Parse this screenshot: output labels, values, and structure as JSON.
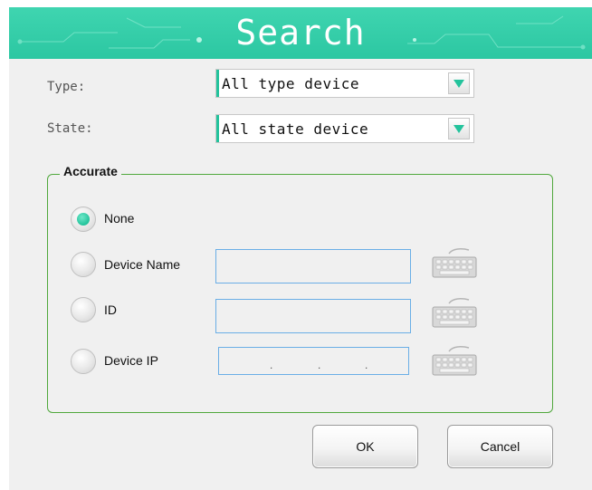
{
  "dialog": {
    "title": "Search"
  },
  "filters": {
    "type_label": "Type:",
    "type_value": "All type device",
    "state_label": "State:",
    "state_value": "All state device"
  },
  "accurate": {
    "legend": "Accurate",
    "options": [
      {
        "label": "None",
        "selected": true
      },
      {
        "label": "Device Name",
        "selected": false
      },
      {
        "label": "ID",
        "selected": false
      },
      {
        "label": "Device IP",
        "selected": false
      }
    ],
    "device_name_value": "",
    "id_value": "",
    "ip_separators": [
      ".",
      ".",
      "."
    ]
  },
  "buttons": {
    "ok": "OK",
    "cancel": "Cancel"
  },
  "colors": {
    "accent": "#23c39c",
    "title_bg": "#2cc7a2",
    "group_border": "#50a83c",
    "field_border": "#6aaee6"
  },
  "icons": {
    "keyboard": "keyboard-icon",
    "dropdown": "dropdown-arrow-icon"
  }
}
